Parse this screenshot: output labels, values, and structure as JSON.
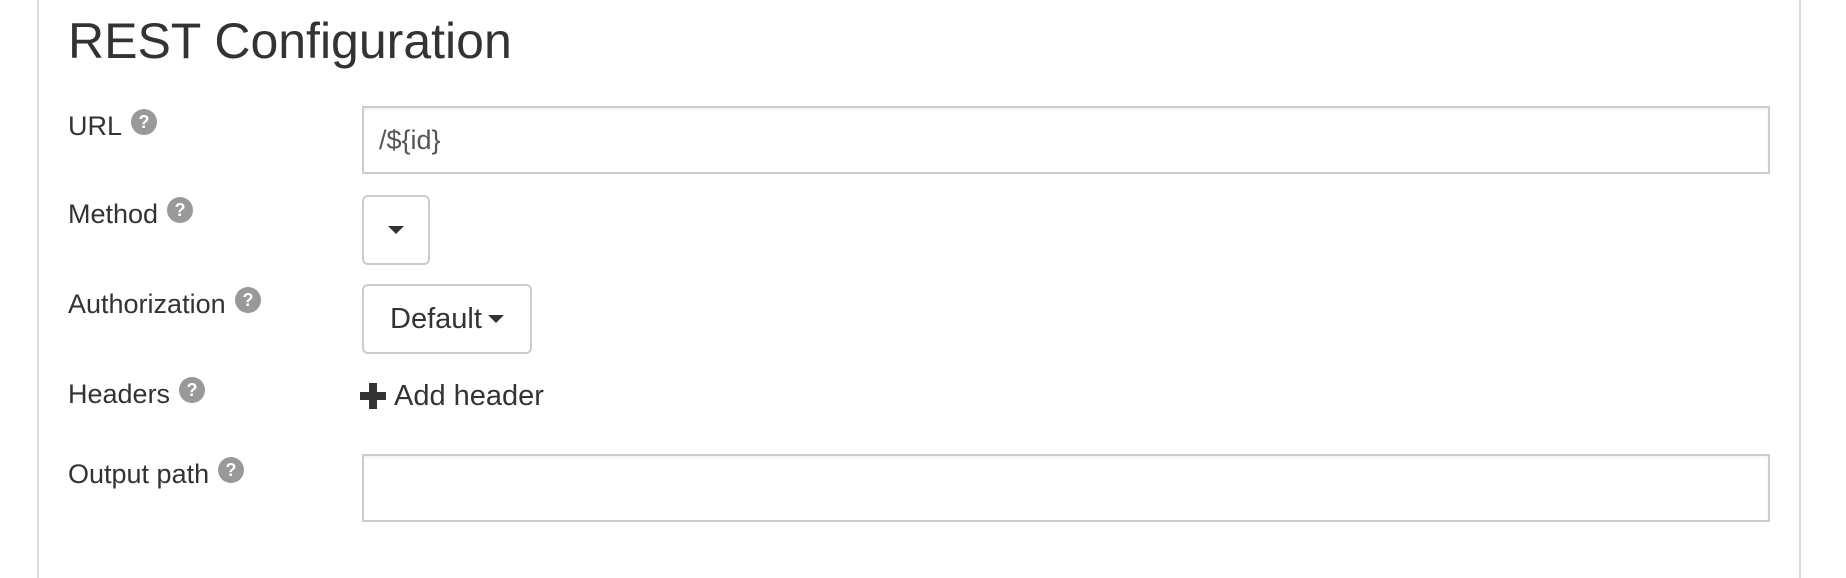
{
  "section": {
    "title": "REST Configuration"
  },
  "fields": {
    "url": {
      "label": "URL",
      "value": "/${id}",
      "help_icon": "question-circle-icon"
    },
    "method": {
      "label": "Method",
      "selected": "",
      "help_icon": "question-circle-icon"
    },
    "authorization": {
      "label": "Authorization",
      "selected": "Default",
      "help_icon": "question-circle-icon"
    },
    "headers": {
      "label": "Headers",
      "add_label": "Add header",
      "add_icon": "plus-icon",
      "help_icon": "question-circle-icon"
    },
    "output_path": {
      "label": "Output path",
      "value": "",
      "help_icon": "question-circle-icon"
    }
  },
  "colors": {
    "text": "#333333",
    "help_icon": "#999999",
    "border": "#cccccc",
    "panel_border": "#dddddd"
  }
}
